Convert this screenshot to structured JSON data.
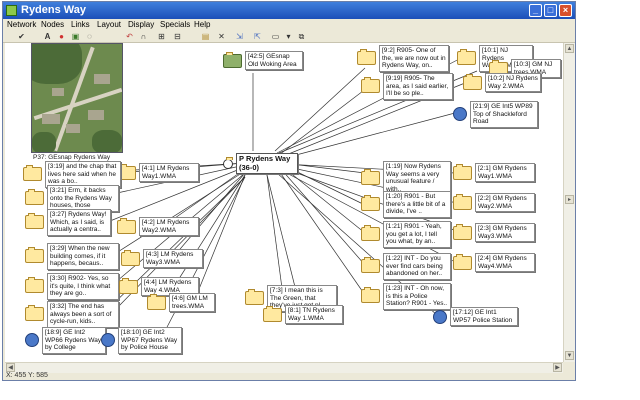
{
  "window": {
    "title": "Rydens Way",
    "title_icon": "network-app-icon"
  },
  "menu": [
    "Network",
    "Nodes",
    "Links",
    "Layout",
    "Display",
    "Specials",
    "Help"
  ],
  "toolbar": [
    "check-icon",
    "text-icon",
    "color-wheel-icon",
    "image-icon",
    "speech-bubble-icon",
    "undo-icon",
    "link-icon",
    "grid-icon",
    "align-icon",
    "folder-icon",
    "delete-icon",
    "connect-icon",
    "disconnect-icon",
    "layout-icon",
    "dropdown-icon",
    "copy-icon"
  ],
  "photo": {
    "caption": "P37: GEsnap Rydens Way"
  },
  "center_node": {
    "label": "P Rydens Way",
    "sublabel": "(36-0)"
  },
  "nodes": [
    {
      "id": "n1",
      "label": "[4:1] LM Rydens Way1.WMA",
      "icon": "audio-file-icon"
    },
    {
      "id": "n2",
      "label": "[3:19] and the chap that lives here said when he was a bo..",
      "icon": "audio-file-icon"
    },
    {
      "id": "n3",
      "label": "[3:21] Erm, it backs onto the Rydens Way houses, those",
      "icon": "audio-file-icon"
    },
    {
      "id": "n4",
      "label": "[3:27] Rydens Way! Which, as I said, is actually a centra..",
      "icon": "audio-file-icon"
    },
    {
      "id": "n5",
      "label": "[4:2] LM Rydens Way2.WMA",
      "icon": "audio-file-icon"
    },
    {
      "id": "n6",
      "label": "[3:29] When the new building comes, if it happens, becaus..",
      "icon": "audio-file-icon"
    },
    {
      "id": "n7",
      "label": "[4:3] LM Rydens Way3.WMA",
      "icon": "audio-file-icon"
    },
    {
      "id": "n8",
      "label": "[3:30] R902- Yes, so it's quite, I think what they are go..",
      "icon": "audio-file-icon"
    },
    {
      "id": "n9",
      "label": "[4:4] LM Rydens Way 4.WMA",
      "icon": "audio-file-icon"
    },
    {
      "id": "n10",
      "label": "[4:6] GM LM trees.WMA",
      "icon": "audio-file-icon"
    },
    {
      "id": "n11",
      "label": "[3:32] The end has always been a sort of cycle-run, kids..",
      "icon": "audio-file-icon"
    },
    {
      "id": "n12",
      "label": "[18:9] GE Int2 WP66 Rydens Way by College",
      "icon": "image-file-icon"
    },
    {
      "id": "n13",
      "label": "[18:10] GE Int2 WP67 Rydens Way by Police House",
      "icon": "image-file-icon"
    },
    {
      "id": "n14",
      "label": "[42:5] GEsnap Old Woking Area",
      "icon": "photo-file-icon"
    },
    {
      "id": "n15",
      "label": "[9:2] R905- One of the, we are now out in Rydens Way, on..",
      "icon": "audio-file-icon"
    },
    {
      "id": "n16",
      "label": "[10:1] NJ Rydens Way1.WMA",
      "icon": "audio-file-icon"
    },
    {
      "id": "n17",
      "label": "[10:3] GM NJ trees.WMA",
      "icon": "audio-file-icon"
    },
    {
      "id": "n18",
      "label": "[9:19] R905- The area, as I said earlier, I'll be so ple..",
      "icon": "audio-file-icon"
    },
    {
      "id": "n19",
      "label": "[10:2] NJ Rydens Way 2.WMA",
      "icon": "audio-file-icon"
    },
    {
      "id": "n20",
      "label": "[21:9] GE Int5 WP89 Top of Shackleford Road",
      "icon": "image-file-icon"
    },
    {
      "id": "n21",
      "label": "[1:19] Now Rydens Way seems a very unusual feature / with..",
      "icon": "audio-file-icon"
    },
    {
      "id": "n22",
      "label": "[2:1] GM Rydens Way1.WMA",
      "icon": "audio-file-icon"
    },
    {
      "id": "n23",
      "label": "[1:20] R901 - But there's a little bit of a divide, I've ..",
      "icon": "audio-file-icon"
    },
    {
      "id": "n24",
      "label": "[2:2] GM Rydens Way2.WMA",
      "icon": "audio-file-icon"
    },
    {
      "id": "n25",
      "label": "[1:21] R901 - Yeah, you get a lot, I tell you what, by an..",
      "icon": "audio-file-icon"
    },
    {
      "id": "n26",
      "label": "[2:3] GM Rydens Way3.WMA",
      "icon": "audio-file-icon"
    },
    {
      "id": "n27",
      "label": "[1:22] INT - Do you ever find cars being abandoned on her..",
      "icon": "audio-file-icon"
    },
    {
      "id": "n28",
      "label": "[2:4] GM Rydens Way4.WMA",
      "icon": "audio-file-icon"
    },
    {
      "id": "n29",
      "label": "[1:23] INT - Oh now, is this a Police Station? R901 - Yes..",
      "icon": "audio-file-icon"
    },
    {
      "id": "n30",
      "label": "[17:12] GE Int1 WP57 Police Station",
      "icon": "image-file-icon"
    },
    {
      "id": "n31",
      "label": "[7:3] I mean this is The Green, that they've just got pl..",
      "icon": "audio-file-icon"
    },
    {
      "id": "n32",
      "label": "[8:1] TN Rydens Way 1.WMA",
      "icon": "audio-file-icon"
    }
  ],
  "status": {
    "coords": "X: 455 Y: 585"
  },
  "colors": {
    "titlebar": "#1c4fb8",
    "link": "#333333",
    "note_icon": "#ffe9a0"
  }
}
